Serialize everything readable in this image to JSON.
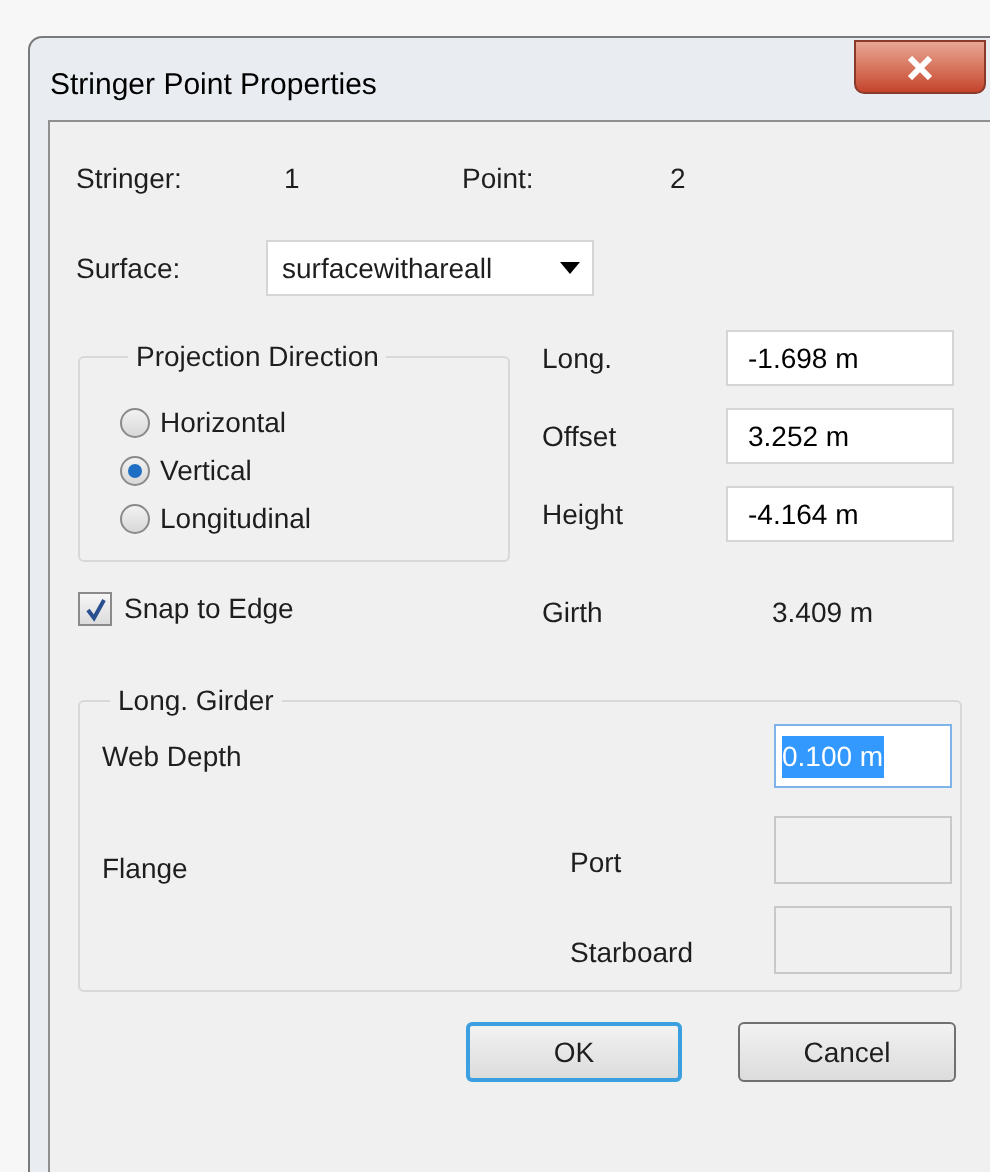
{
  "window": {
    "title": "Stringer Point Properties"
  },
  "header": [
    {
      "label": "Stringer:",
      "value": "1"
    },
    {
      "label": "Point:",
      "value": "2"
    }
  ],
  "surface": {
    "label": "Surface:",
    "value": "surfacewithareall"
  },
  "projection": {
    "title": "Projection Direction",
    "options": [
      {
        "label": "Horizontal",
        "selected": false
      },
      {
        "label": "Vertical",
        "selected": true
      },
      {
        "label": "Longitudinal",
        "selected": false
      }
    ]
  },
  "coords": [
    {
      "label": "Long.",
      "value": "-1.698 m",
      "kind": "field"
    },
    {
      "label": "Offset",
      "value": "3.252 m",
      "kind": "field"
    },
    {
      "label": "Height",
      "value": "-4.164 m",
      "kind": "field"
    },
    {
      "label": "Girth",
      "value": "3.409 m",
      "kind": "readout"
    }
  ],
  "snap": {
    "label": "Snap to Edge",
    "checked": true
  },
  "girder": {
    "title": "Long. Girder",
    "web_depth": {
      "label": "Web Depth",
      "value": "0.100 m",
      "selected": true
    },
    "flange": {
      "label": "Flange",
      "sides": [
        {
          "label": "Port",
          "disabled": true
        },
        {
          "label": "Starboard",
          "disabled": true
        }
      ]
    }
  },
  "buttons": [
    {
      "label": "OK",
      "default": true
    },
    {
      "label": "Cancel",
      "default": false
    }
  ]
}
